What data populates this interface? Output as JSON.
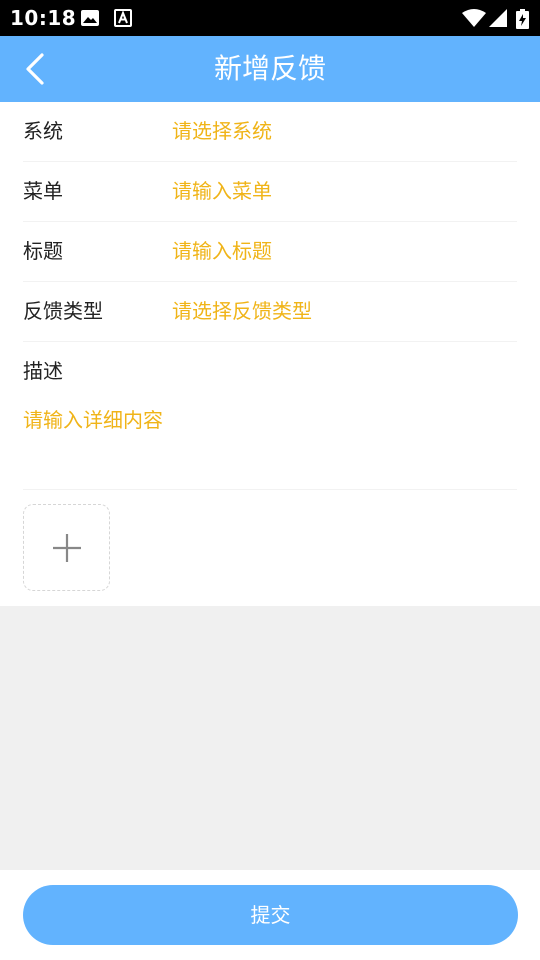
{
  "status_bar": {
    "time": "10:18",
    "icons": [
      "image-icon",
      "font-a-icon",
      "wifi-icon",
      "signal-icon",
      "battery-charging-icon"
    ]
  },
  "header": {
    "title": "新增反馈",
    "back_icon": "chevron-left-icon",
    "background": "#62b3fe"
  },
  "form": {
    "rows": [
      {
        "label": "系统",
        "placeholder": "请选择系统"
      },
      {
        "label": "菜单",
        "placeholder": "请输入菜单"
      },
      {
        "label": "标题",
        "placeholder": "请输入标题"
      },
      {
        "label": "反馈类型",
        "placeholder": "请选择反馈类型"
      }
    ],
    "description": {
      "label": "描述",
      "placeholder": "请输入详细内容"
    },
    "upload_icon": "plus-icon"
  },
  "footer": {
    "submit_label": "提交"
  },
  "colors": {
    "accent": "#62b3fe",
    "placeholder": "#f0b418",
    "page_background": "#f0f0f0"
  }
}
